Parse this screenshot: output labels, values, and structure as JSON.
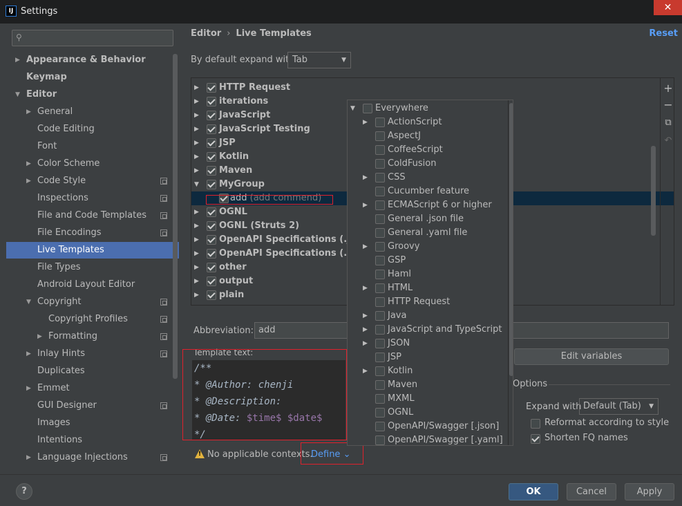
{
  "window": {
    "title": "Settings",
    "app_icon": "IJ",
    "close_glyph": "✕"
  },
  "sidebar": {
    "search_placeholder": "",
    "items": [
      {
        "label": "Appearance & Behavior",
        "bold": true,
        "arrow": "▶"
      },
      {
        "label": "Keymap",
        "bold": true
      },
      {
        "label": "Editor",
        "bold": true,
        "arrow": "▼"
      },
      {
        "label": "General",
        "arrow": "▶"
      },
      {
        "label": "Code Editing"
      },
      {
        "label": "Font"
      },
      {
        "label": "Color Scheme",
        "arrow": "▶"
      },
      {
        "label": "Code Style",
        "arrow": "▶",
        "copy_icon": true
      },
      {
        "label": "Inspections",
        "copy_icon": true
      },
      {
        "label": "File and Code Templates",
        "copy_icon": true
      },
      {
        "label": "File Encodings",
        "copy_icon": true
      },
      {
        "label": "Live Templates",
        "selected": true
      },
      {
        "label": "File Types"
      },
      {
        "label": "Android Layout Editor"
      },
      {
        "label": "Copyright",
        "arrow": "▼",
        "copy_icon": true
      },
      {
        "label": "Copyright Profiles",
        "copy_icon": true
      },
      {
        "label": "Formatting",
        "arrow": "▶",
        "copy_icon": true
      },
      {
        "label": "Inlay Hints",
        "arrow": "▶",
        "copy_icon": true
      },
      {
        "label": "Duplicates"
      },
      {
        "label": "Emmet",
        "arrow": "▶"
      },
      {
        "label": "GUI Designer",
        "copy_icon": true
      },
      {
        "label": "Images"
      },
      {
        "label": "Intentions"
      },
      {
        "label": "Language Injections",
        "arrow": "▶",
        "copy_icon": true
      }
    ]
  },
  "header": {
    "breadcrumb": [
      "Editor",
      "Live Templates"
    ],
    "breadcrumb_sep": "›",
    "reset_label": "Reset"
  },
  "expand": {
    "label": "By default expand with",
    "value": "Tab"
  },
  "tree": {
    "groups": [
      {
        "label": "HTTP Request",
        "checked": true,
        "arrow": "▶"
      },
      {
        "label": "iterations",
        "checked": true,
        "arrow": "▶"
      },
      {
        "label": "JavaScript",
        "checked": true,
        "arrow": "▶"
      },
      {
        "label": "JavaScript Testing",
        "checked": true,
        "arrow": "▶"
      },
      {
        "label": "JSP",
        "checked": true,
        "arrow": "▶"
      },
      {
        "label": "Kotlin",
        "checked": true,
        "arrow": "▶"
      },
      {
        "label": "Maven",
        "checked": true,
        "arrow": "▶"
      },
      {
        "label": "MyGroup",
        "checked": true,
        "arrow": "▼"
      },
      {
        "label": "add",
        "desc": " (add commend)",
        "checked": true,
        "child": true
      },
      {
        "label": "OGNL",
        "checked": true,
        "arrow": "▶"
      },
      {
        "label": "OGNL (Struts 2)",
        "checked": true,
        "arrow": "▶"
      },
      {
        "label": "OpenAPI Specifications (.json)",
        "checked": true,
        "arrow": "▶"
      },
      {
        "label": "OpenAPI Specifications (.yaml)",
        "checked": true,
        "arrow": "▶"
      },
      {
        "label": "other",
        "checked": true,
        "arrow": "▶"
      },
      {
        "label": "output",
        "checked": true,
        "arrow": "▶"
      },
      {
        "label": "plain",
        "checked": true,
        "arrow": "▶"
      }
    ],
    "tools": [
      "+",
      "−",
      "⧉",
      "↶"
    ]
  },
  "form": {
    "abbreviation_label": "Abbreviation:",
    "abbreviation_value": "add",
    "template_text_label": "Template text:",
    "template_lines": [
      {
        "text": "/**"
      },
      {
        "text": "* @Author: chenji"
      },
      {
        "text": "* @Description:"
      },
      {
        "prefix": "* @Date: ",
        "var1": "$time$",
        "var2": "$date$"
      },
      {
        "text": "*/"
      }
    ],
    "edit_variables_label": "Edit variables",
    "options_label": "Options",
    "expand_with_label": "Expand with",
    "expand_with_value": "Default (Tab)",
    "reformat_label": "Reformat according to style",
    "reformat_checked": false,
    "shorten_label": "Shorten FQ names",
    "shorten_checked": true,
    "warning_text": "No applicable contexts.",
    "define_label": "Define ⌄"
  },
  "context_popup": {
    "items": [
      {
        "label": "Everywhere",
        "arrow": "▼",
        "level": 0
      },
      {
        "label": "ActionScript",
        "arrow": "▶",
        "level": 1
      },
      {
        "label": "AspectJ",
        "level": 1
      },
      {
        "label": "CoffeeScript",
        "level": 1
      },
      {
        "label": "ColdFusion",
        "level": 1
      },
      {
        "label": "CSS",
        "arrow": "▶",
        "level": 1
      },
      {
        "label": "Cucumber feature",
        "level": 1
      },
      {
        "label": "ECMAScript 6 or higher",
        "arrow": "▶",
        "level": 1
      },
      {
        "label": "General .json file",
        "level": 1
      },
      {
        "label": "General .yaml file",
        "level": 1
      },
      {
        "label": "Groovy",
        "arrow": "▶",
        "level": 1
      },
      {
        "label": "GSP",
        "level": 1
      },
      {
        "label": "Haml",
        "level": 1
      },
      {
        "label": "HTML",
        "arrow": "▶",
        "level": 1
      },
      {
        "label": "HTTP Request",
        "level": 1
      },
      {
        "label": "Java",
        "arrow": "▶",
        "level": 1
      },
      {
        "label": "JavaScript and TypeScript",
        "arrow": "▶",
        "level": 1
      },
      {
        "label": "JSON",
        "arrow": "▶",
        "level": 1
      },
      {
        "label": "JSP",
        "level": 1
      },
      {
        "label": "Kotlin",
        "arrow": "▶",
        "level": 1
      },
      {
        "label": "Maven",
        "level": 1
      },
      {
        "label": "MXML",
        "level": 1
      },
      {
        "label": "OGNL",
        "level": 1
      },
      {
        "label": "OpenAPI/Swagger [.json]",
        "level": 1
      },
      {
        "label": "OpenAPI/Swagger [.yaml]",
        "level": 1
      }
    ]
  },
  "footer": {
    "help_label": "?",
    "ok_label": "OK",
    "cancel_label": "Cancel",
    "apply_label": "Apply"
  },
  "colors": {
    "accent": "#4b6eaf",
    "link": "#589df6",
    "highlight_border": "#e0212c",
    "warning": "#e2b33e"
  }
}
